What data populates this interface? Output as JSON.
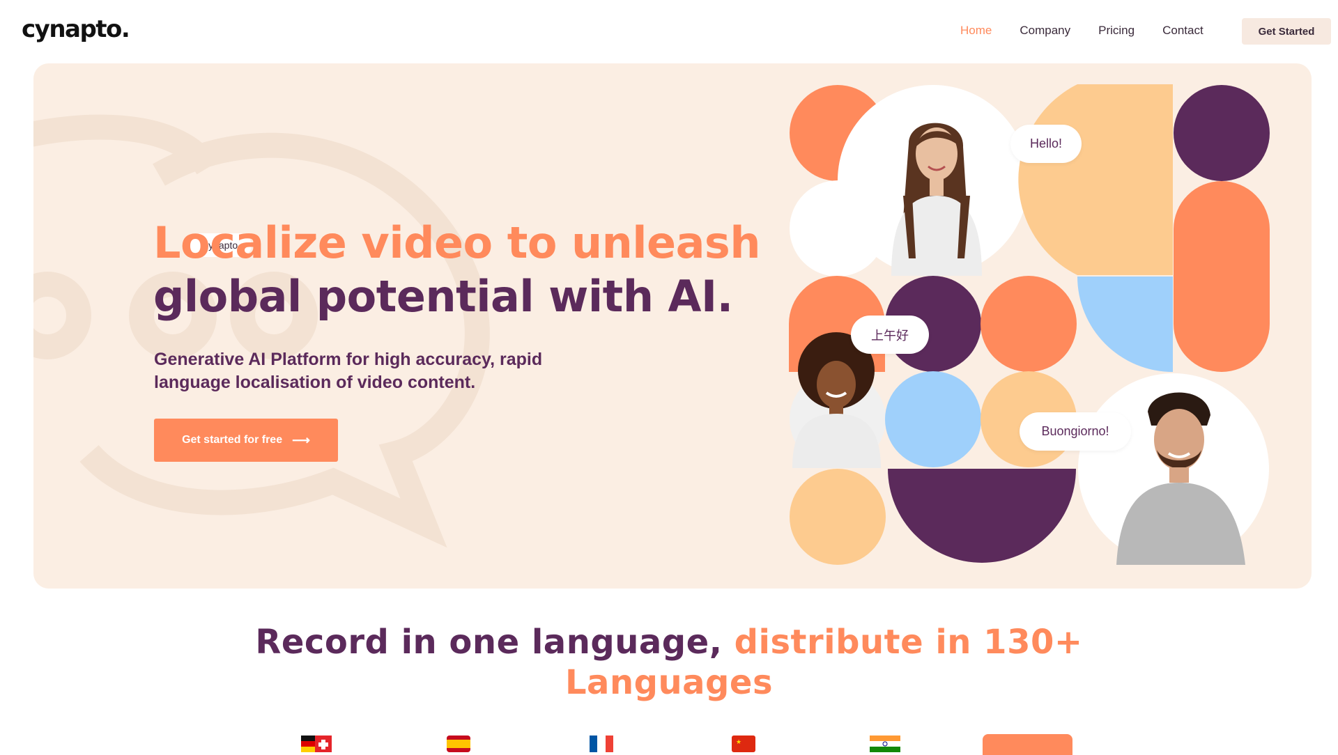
{
  "nav": {
    "logo": "cynapto.",
    "links": [
      {
        "label": "Home",
        "active": true
      },
      {
        "label": "Company",
        "active": false
      },
      {
        "label": "Pricing",
        "active": false
      },
      {
        "label": "Contact",
        "active": false
      }
    ],
    "cta_label": "Get Started"
  },
  "hero": {
    "badge": "Cynapto",
    "title_line1": "Localize video to unleash",
    "title_line2": "global potential with AI.",
    "subtitle": "Generative AI Platform for high accuracy, rapid language localisation of video content.",
    "cta_label": "Get started for free",
    "cta_icon": "arrow-right-icon",
    "bubbles": [
      "Hello!",
      "上午好",
      "Buongiorno!"
    ]
  },
  "languages_section": {
    "title_dark": "Record in one language, ",
    "title_accent": "distribute in 130+ Languages",
    "flags": [
      "germany-switzerland-flag",
      "spain-flag",
      "france-flag",
      "china-flag",
      "india-flag"
    ]
  },
  "colors": {
    "accent": "#ff8a5c",
    "purple": "#5b2a5b",
    "hero_bg": "#fbeee3",
    "peach": "#fdcb8f",
    "blue": "#9fd0fb"
  }
}
